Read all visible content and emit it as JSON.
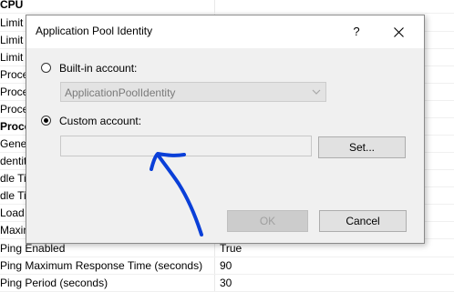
{
  "background_rows": [
    {
      "name": "CPU",
      "value": "",
      "bold": true
    },
    {
      "name": "Limit",
      "value": ""
    },
    {
      "name": "Limit A",
      "value": ""
    },
    {
      "name": "Limit I",
      "value": ""
    },
    {
      "name": "Proces",
      "value": ""
    },
    {
      "name": "Proces",
      "value": ""
    },
    {
      "name": "Proces",
      "value": ""
    },
    {
      "name": "Proce",
      "value": "",
      "bold": true
    },
    {
      "name": "Gener",
      "value": ""
    },
    {
      "name": "dentit",
      "value": ""
    },
    {
      "name": "dle Ti",
      "value": ""
    },
    {
      "name": "dle Ti",
      "value": ""
    },
    {
      "name": "Load U",
      "value": ""
    },
    {
      "name": "Maxim",
      "value": ""
    },
    {
      "name": "Ping Enabled",
      "value": "True"
    },
    {
      "name": "Ping Maximum Response Time (seconds)",
      "value": "90"
    },
    {
      "name": "Ping Period (seconds)",
      "value": "30"
    }
  ],
  "dialog": {
    "title": "Application Pool Identity",
    "help_label": "?",
    "builtin_label": "Built-in account:",
    "builtin_selected": "ApplicationPoolIdentity",
    "custom_label": "Custom account:",
    "custom_value": "",
    "set_label": "Set...",
    "ok_label": "OK",
    "cancel_label": "Cancel",
    "selected_option": "custom"
  },
  "colors": {
    "annotation": "#0a3fd8",
    "dialog_bg": "#f0f0f0"
  }
}
